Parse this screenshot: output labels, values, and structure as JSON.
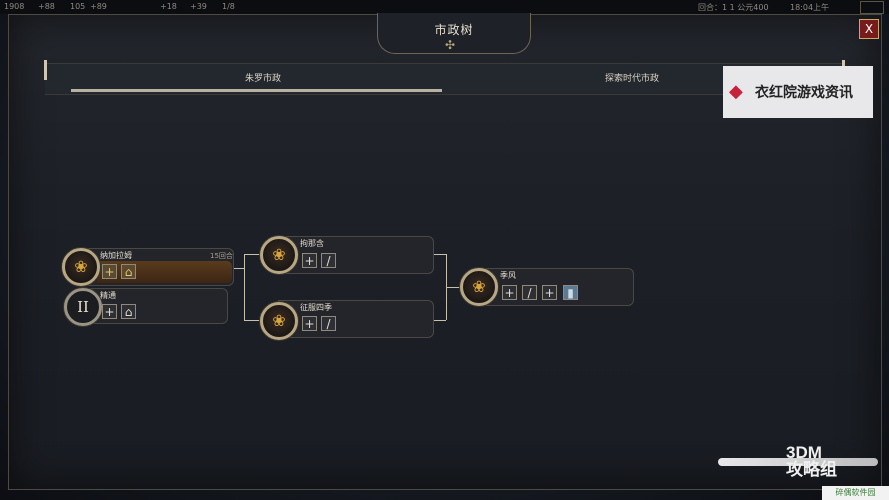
{
  "status_bar": {
    "resources": [
      "1908",
      "+88",
      "105",
      "+89",
      "+18",
      "+39",
      "1/8"
    ],
    "turn_label": "回合：1 1  公元400",
    "clock": "18:04上午"
  },
  "window": {
    "title": "市政树",
    "close_glyph": "X"
  },
  "tabs": [
    {
      "label": "朱罗市政"
    },
    {
      "label": "探索时代市政"
    }
  ],
  "watermark": {
    "brand": "衣红院游戏资讯",
    "bottom_logo": "3DM\n攻略组",
    "site": "碎偶软件园"
  },
  "civics": [
    {
      "name": "纳加拉姆",
      "turns": "15回合",
      "icon": "lotus-medal-icon",
      "progress": 1.0,
      "chips": [
        "plus-chip",
        "building-chip"
      ]
    },
    {
      "name": "精通",
      "icon": "roman-numeral-two-icon",
      "medal_text": "II",
      "chips": [
        "plus-chip",
        "building-chip"
      ]
    },
    {
      "name": "拘那含",
      "icon": "lotus-medal-icon",
      "chips": [
        "plus-chip",
        "quill-chip"
      ]
    },
    {
      "name": "征服四季",
      "icon": "lotus-medal-icon",
      "chips": [
        "plus-chip",
        "quill-chip"
      ]
    },
    {
      "name": "季风",
      "icon": "lotus-medal-icon",
      "chips": [
        "plus-chip",
        "quill-chip",
        "plus-chip",
        "card-chip"
      ]
    }
  ],
  "colors": {
    "accent_gold": "#b7a784",
    "close_red": "#7a1b1b",
    "progress_brown": "#5a3b1d"
  }
}
